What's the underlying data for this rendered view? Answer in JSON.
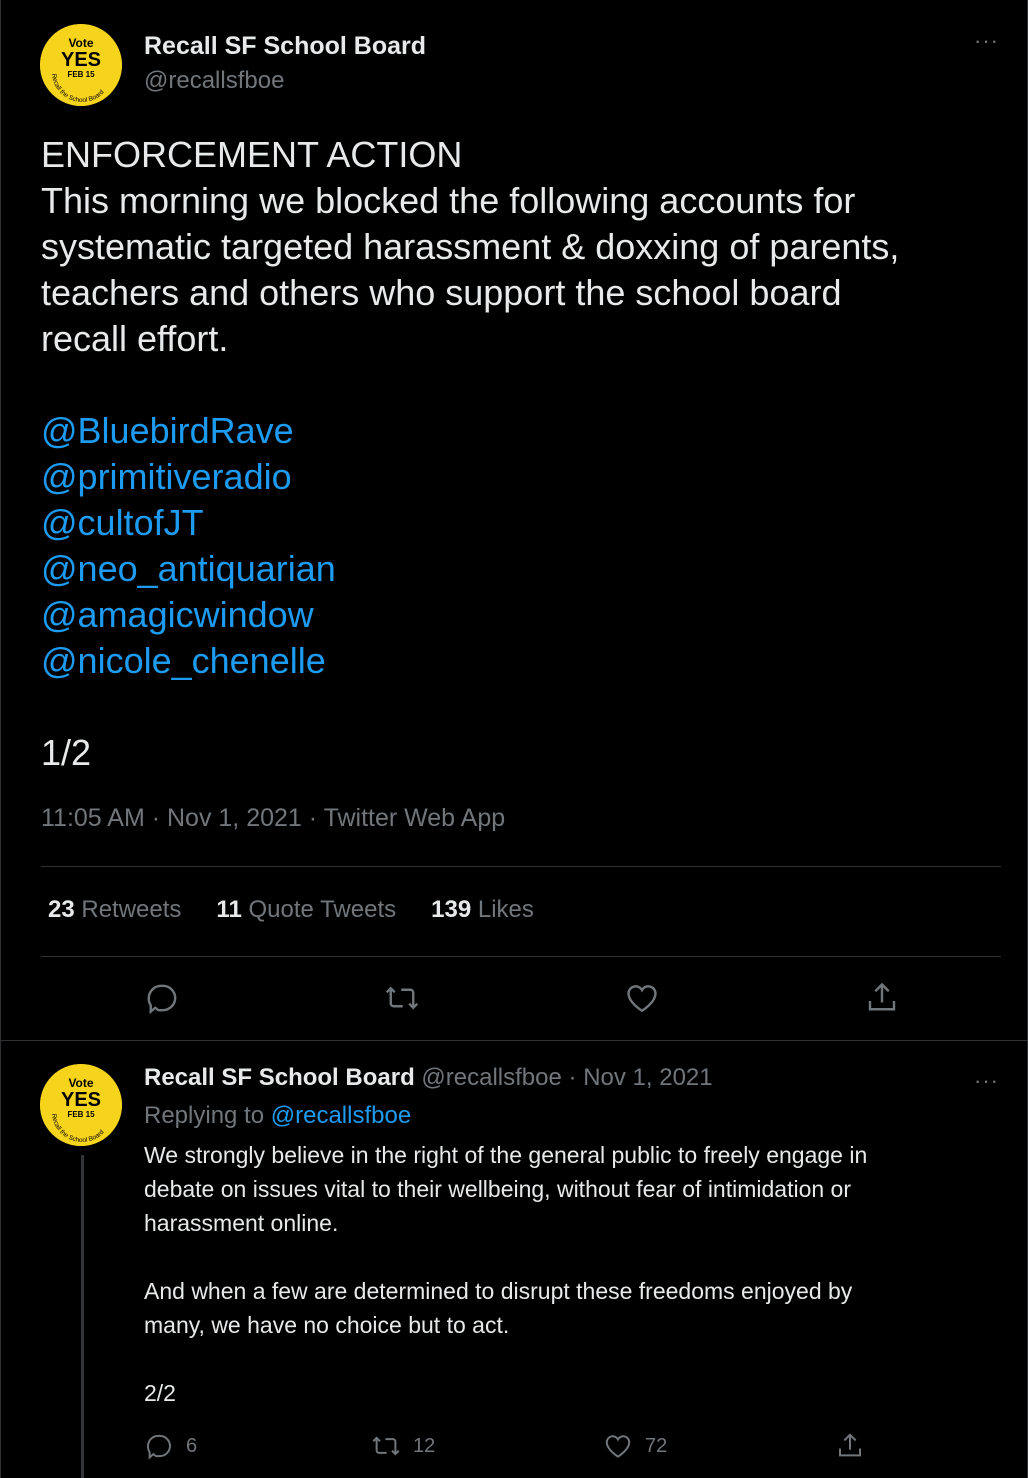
{
  "main_tweet": {
    "author_name": "Recall SF School Board",
    "author_handle": "@recallsfboe",
    "avatar": {
      "line1": "Vote",
      "line2": "YES",
      "line3": "FEB 15",
      "arc_text": "Recall the School Board",
      "bg_color": "#f7d41c"
    },
    "more_icon": "···",
    "text_lines": [
      "ENFORCEMENT ACTION",
      "This morning we blocked the following accounts for",
      "systematic targeted harassment & doxxing of parents,",
      "teachers and others who support the school board",
      "recall effort."
    ],
    "mentions": [
      "@BluebirdRave",
      "@primitiveradio",
      "@cultofJT",
      "@neo_antiquarian",
      "@amagicwindow",
      "@nicole_chenelle"
    ],
    "counter": "1/2",
    "meta": "11:05 AM · Nov 1, 2021 · Twitter Web App",
    "stats": {
      "retweets_count": "23",
      "retweets_label": "Retweets",
      "quotes_count": "11",
      "quotes_label": "Quote Tweets",
      "likes_count": "139",
      "likes_label": "Likes"
    }
  },
  "reply_tweet": {
    "author_name": "Recall SF School Board",
    "author_handle": "@recallsfboe",
    "separator": "·",
    "date": "Nov 1, 2021",
    "replying_prefix": "Replying to",
    "replying_handle": "@recallsfboe",
    "more_icon": "···",
    "paragraph1_lines": [
      "We strongly believe in the right of the general public to freely engage in",
      "debate on issues vital to their wellbeing, without fear of intimidation or",
      "harassment online."
    ],
    "paragraph2_lines": [
      "And when a few are determined to disrupt these freedoms enjoyed by",
      "many, we have no choice but to act."
    ],
    "counter": "2/2",
    "actions": {
      "reply_count": "6",
      "retweet_count": "12",
      "like_count": "72"
    }
  },
  "colors": {
    "background": "#000000",
    "text": "#e7e9ea",
    "muted": "#71767b",
    "link": "#1d9bf0",
    "divider": "#2f3336"
  }
}
